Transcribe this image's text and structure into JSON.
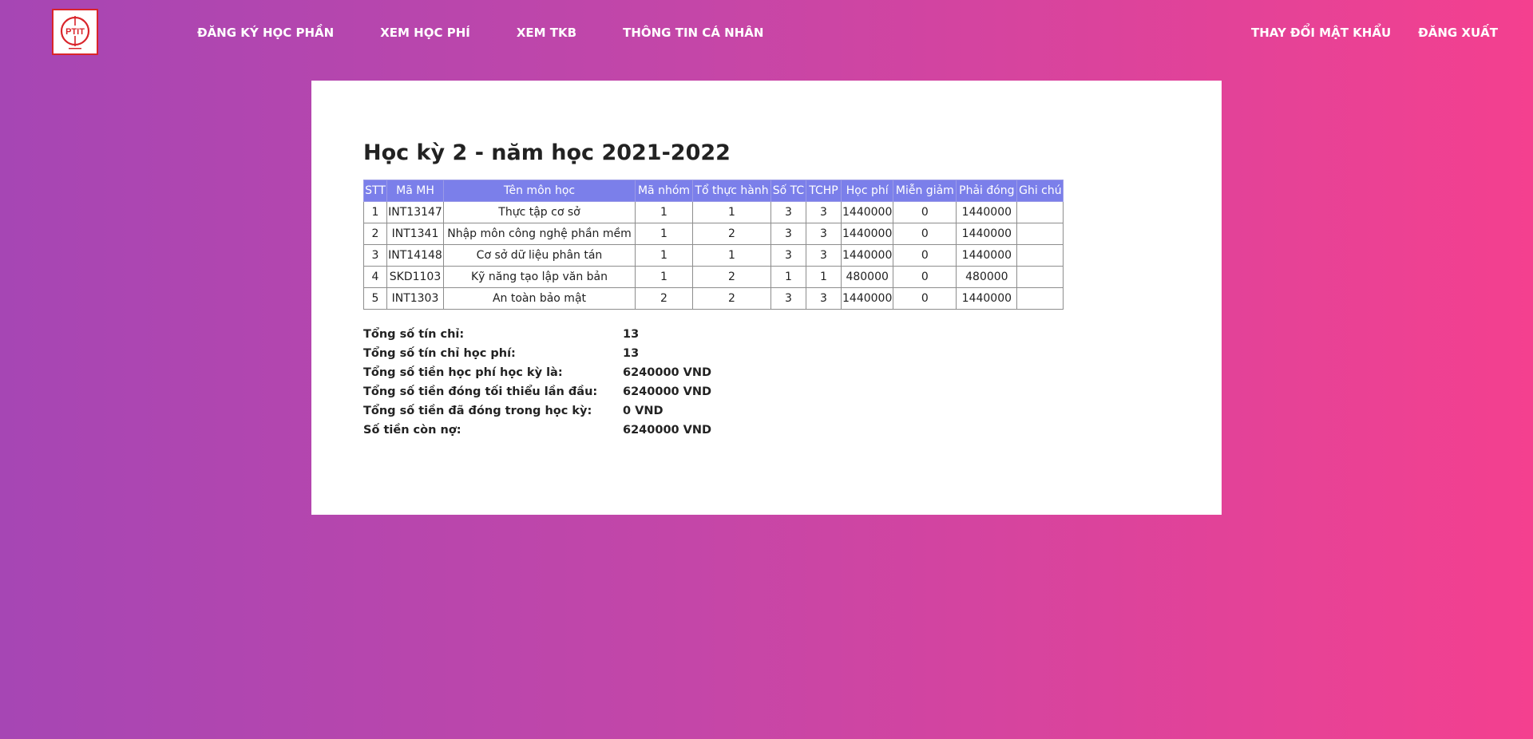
{
  "nav": {
    "left": [
      {
        "label": "ĐĂNG KÝ HỌC PHẦN"
      },
      {
        "label": "XEM HỌC PHÍ"
      },
      {
        "label": "XEM TKB"
      },
      {
        "label": "THÔNG TIN CÁ NHÂN"
      }
    ],
    "right": [
      {
        "label": "THAY ĐỔI MẬT KHẨU"
      },
      {
        "label": "ĐĂNG XUẤT"
      }
    ]
  },
  "logo": {
    "icon": "ptit-logo-icon",
    "text": "PTIT"
  },
  "main": {
    "title": "Học kỳ 2 - năm học 2021-2022",
    "table": {
      "headers": [
        "STT",
        "Mã MH",
        "Tên môn học",
        "Mã nhóm",
        "Tổ thực hành",
        "Số TC",
        "TCHP",
        "Học phí",
        "Miễn giảm",
        "Phải đóng",
        "Ghi chú"
      ],
      "rows": [
        [
          "1",
          "INT13147",
          "Thực tập cơ sở",
          "1",
          "1",
          "3",
          "3",
          "1440000",
          "0",
          "1440000",
          ""
        ],
        [
          "2",
          "INT1341",
          "Nhập môn công nghệ phần mềm",
          "1",
          "2",
          "3",
          "3",
          "1440000",
          "0",
          "1440000",
          ""
        ],
        [
          "3",
          "INT14148",
          "Cơ sở dữ liệu phân tán",
          "1",
          "1",
          "3",
          "3",
          "1440000",
          "0",
          "1440000",
          ""
        ],
        [
          "4",
          "SKD1103",
          "Kỹ năng tạo lập văn bản",
          "1",
          "2",
          "1",
          "1",
          "480000",
          "0",
          "480000",
          ""
        ],
        [
          "5",
          "INT1303",
          "An toàn bảo mật",
          "2",
          "2",
          "3",
          "3",
          "1440000",
          "0",
          "1440000",
          ""
        ]
      ]
    },
    "summary": [
      {
        "label": "Tổng số tín chỉ:",
        "value": "13"
      },
      {
        "label": "Tổng số tín chỉ học phí:",
        "value": "13"
      },
      {
        "label": "Tổng số tiền học phí học kỳ là:",
        "value": "6240000 VND"
      },
      {
        "label": "Tổng số tiền đóng tối thiểu lần đầu:",
        "value": "6240000 VND"
      },
      {
        "label": "Tổng số tiền đã đóng trong học kỳ:",
        "value": "0 VND"
      },
      {
        "label": "Số tiền còn nợ:",
        "value": "6240000 VND"
      }
    ]
  },
  "colors": {
    "background_start": "#a646b4",
    "background_end": "#f4408f",
    "table_header": "#7b7fea",
    "logo_red": "#d9252b"
  }
}
